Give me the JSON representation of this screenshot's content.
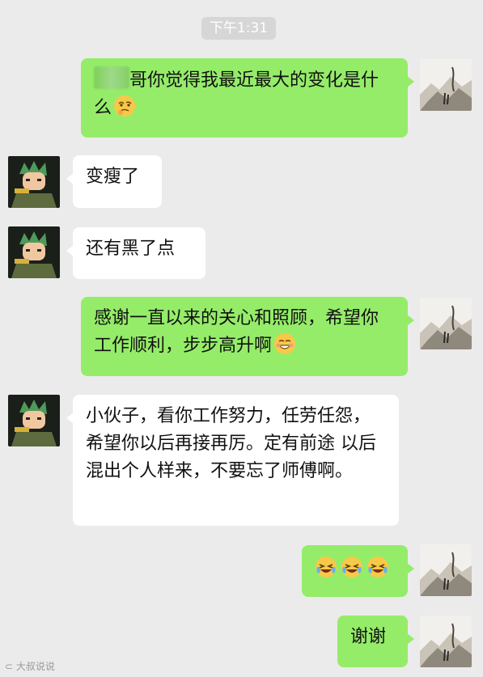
{
  "time_label": "下午1:31",
  "messages": [
    {
      "side": "right",
      "text_after_blur": "哥你觉得我最近最大的变化是什么",
      "emoji": "thinking-face-icon"
    },
    {
      "side": "left",
      "text": "变瘦了"
    },
    {
      "side": "left",
      "text": "还有黑了点"
    },
    {
      "side": "right",
      "text": "感谢一直以来的关心和照顾，希望你工作顺利，步步高升啊",
      "emoji": "grinning-face-icon"
    },
    {
      "side": "left",
      "text": "小伙子，看你工作努力，任劳任怨，希望你以后再接再厉。定有前途 以后混出个人样来，不要忘了师傅啊。"
    },
    {
      "side": "right",
      "emojis": [
        "crying-laughing-icon",
        "crying-laughing-icon",
        "crying-laughing-icon"
      ]
    },
    {
      "side": "right",
      "text": "谢谢"
    }
  ],
  "watermark": "大叔说说",
  "colors": {
    "background": "#ebebeb",
    "sent_bubble": "#95ec69",
    "received_bubble": "#ffffff"
  }
}
